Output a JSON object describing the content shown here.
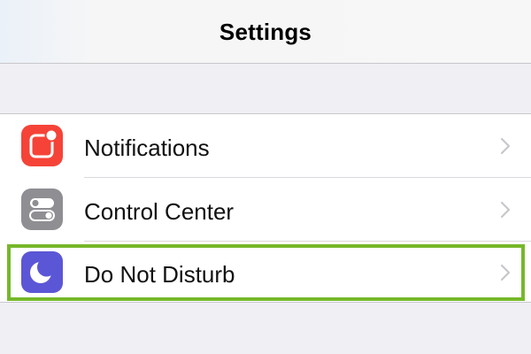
{
  "nav": {
    "title": "Settings"
  },
  "colors": {
    "notifications_icon_bg": "#f54338",
    "control_center_icon_bg": "#8e8e93",
    "do_not_disturb_icon_bg": "#5b56d6",
    "highlight": "#76b82a",
    "chevron": "#c7c7cc"
  },
  "settings": {
    "items": [
      {
        "label": "Notifications",
        "icon": "notifications-icon"
      },
      {
        "label": "Control Center",
        "icon": "control-center-icon"
      },
      {
        "label": "Do Not Disturb",
        "icon": "moon-icon"
      }
    ]
  }
}
